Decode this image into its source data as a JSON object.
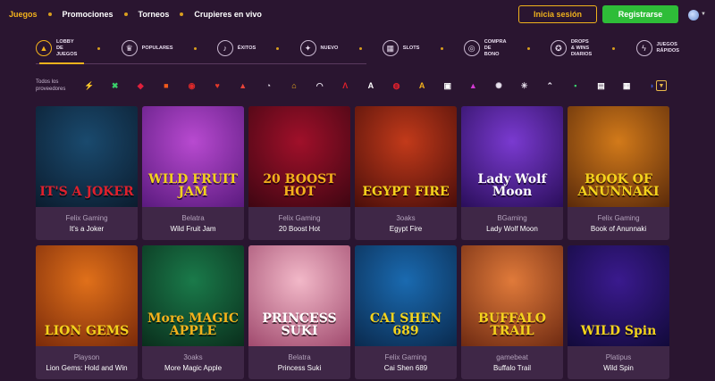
{
  "nav": {
    "links": [
      "Juegos",
      "Promociones",
      "Torneos",
      "Crupieres en vivo"
    ],
    "login_label": "Inicia sesión",
    "register_label": "Registrarse"
  },
  "categories": [
    {
      "label1": "LOBBY",
      "label2": "DE",
      "label3": "JUEGOS",
      "icon": "lobby-icon",
      "glyph": "▲"
    },
    {
      "label1": "POPULARES",
      "label2": "",
      "label3": "",
      "icon": "crown-icon",
      "glyph": "♛"
    },
    {
      "label1": "ÉXITOS",
      "label2": "",
      "label3": "",
      "icon": "microphone-icon",
      "glyph": "♪"
    },
    {
      "label1": "NUEVO",
      "label2": "",
      "label3": "",
      "icon": "new-badge-icon",
      "glyph": "✦"
    },
    {
      "label1": "SLOTS",
      "label2": "",
      "label3": "",
      "icon": "slots-icon",
      "glyph": "▦"
    },
    {
      "label1": "COMPRA",
      "label2": "DE",
      "label3": "BONO",
      "icon": "coins-icon",
      "glyph": "◎"
    },
    {
      "label1": "DROPS",
      "label2": "& WINS",
      "label3": "DIARIOS",
      "icon": "trophy-icon",
      "glyph": "✪"
    },
    {
      "label1": "JUEGOS",
      "label2": "RÁPIDOS",
      "label3": "",
      "icon": "lightning-icon",
      "glyph": "ϟ"
    }
  ],
  "providers": {
    "label1": "Todos los",
    "label2": "proveedores",
    "logos": [
      {
        "icon": "provider-logo-1",
        "glyph": "⚡",
        "color": "#f3b21c"
      },
      {
        "icon": "provider-logo-2",
        "glyph": "✖",
        "color": "#3ad06a"
      },
      {
        "icon": "provider-logo-3",
        "glyph": "◆",
        "color": "#e0203c"
      },
      {
        "icon": "provider-logo-4",
        "glyph": "■",
        "color": "#f05a1c"
      },
      {
        "icon": "provider-logo-5",
        "glyph": "◉",
        "color": "#e02a2a"
      },
      {
        "icon": "provider-logo-6",
        "glyph": "♥",
        "color": "#e23a2a"
      },
      {
        "icon": "provider-logo-7",
        "glyph": "▲",
        "color": "#e8453a"
      },
      {
        "icon": "provider-logo-8",
        "glyph": "◔",
        "color": "#e9e2ee"
      },
      {
        "icon": "provider-logo-9",
        "glyph": "⌂",
        "color": "#f3b21c"
      },
      {
        "icon": "provider-logo-10",
        "glyph": "◠",
        "color": "#e9e2ee"
      },
      {
        "icon": "provider-logo-11",
        "glyph": "Λ",
        "color": "#e0202c"
      },
      {
        "icon": "provider-logo-12",
        "glyph": "A",
        "color": "#ffffff"
      },
      {
        "icon": "provider-logo-13",
        "glyph": "◍",
        "color": "#e0202c"
      },
      {
        "icon": "provider-logo-14",
        "glyph": "A",
        "color": "#f3b21c"
      },
      {
        "icon": "provider-logo-15",
        "glyph": "▣",
        "color": "#ffffff"
      },
      {
        "icon": "provider-logo-16",
        "glyph": "▲",
        "color": "#d43ad4"
      },
      {
        "icon": "provider-logo-17",
        "glyph": "✺",
        "color": "#e9e2ee"
      },
      {
        "icon": "provider-logo-18",
        "glyph": "✳",
        "color": "#e9e2ee"
      },
      {
        "icon": "provider-logo-19",
        "glyph": "⌃",
        "color": "#e9e2ee"
      },
      {
        "icon": "provider-logo-20",
        "glyph": "▪",
        "color": "#3ad06a"
      },
      {
        "icon": "provider-logo-21",
        "glyph": "▤",
        "color": "#ffffff"
      },
      {
        "icon": "provider-logo-22",
        "glyph": "▦",
        "color": "#ffffff"
      },
      {
        "icon": "provider-logo-23",
        "glyph": "◗",
        "color": "#3a5ad0"
      }
    ]
  },
  "games": [
    {
      "provider": "Felix Gaming",
      "name": "It's a Joker",
      "art_title": "IT'S A JOKER",
      "bg1": "#1a4a6e",
      "bg2": "#0b1c2e",
      "tc": "#e0202c"
    },
    {
      "provider": "Belatra",
      "name": "Wild Fruit Jam",
      "art_title": "WILD FRUIT JAM",
      "bg1": "#b84ad0",
      "bg2": "#5a1a7e",
      "tc": "#f3d21c"
    },
    {
      "provider": "Felix Gaming",
      "name": "20 Boost Hot",
      "art_title": "20 BOOST HOT",
      "bg1": "#a0102a",
      "bg2": "#3e0612",
      "tc": "#f3b21c"
    },
    {
      "provider": "3oaks",
      "name": "Egypt Fire",
      "art_title": "EGYPT FIRE",
      "bg1": "#c23a1a",
      "bg2": "#4a0e0a",
      "tc": "#f3d21c"
    },
    {
      "provider": "BGaming",
      "name": "Lady Wolf Moon",
      "art_title": "Lady Wolf Moon",
      "bg1": "#7a3ad0",
      "bg2": "#2a0e5a",
      "tc": "#ffffff"
    },
    {
      "provider": "Felix Gaming",
      "name": "Book of Anunnaki",
      "art_title": "BOOK OF ANUNNAKI",
      "bg1": "#d27a1a",
      "bg2": "#5a2a0a",
      "tc": "#f3d21c"
    },
    {
      "provider": "Playson",
      "name": "Lion Gems: Hold and Win",
      "art_title": "LION GEMS",
      "bg1": "#e0701a",
      "bg2": "#7a2a0a",
      "tc": "#f3d21c"
    },
    {
      "provider": "3oaks",
      "name": "More Magic Apple",
      "art_title": "More MAGIC APPLE",
      "bg1": "#1a7a4a",
      "bg2": "#0a2e1c",
      "tc": "#f3b21c"
    },
    {
      "provider": "Belatra",
      "name": "Princess Suki",
      "art_title": "PRINCESS SUKI",
      "bg1": "#f2b8c8",
      "bg2": "#a04a6e",
      "tc": "#ffffff"
    },
    {
      "provider": "Felix Gaming",
      "name": "Cai Shen 689",
      "art_title": "CAI SHEN 689",
      "bg1": "#1a6ab0",
      "bg2": "#0a2a4e",
      "tc": "#f3d21c"
    },
    {
      "provider": "gamebeat",
      "name": "Buffalo Trail",
      "art_title": "BUFFALO TRAIL",
      "bg1": "#e07a3a",
      "bg2": "#6e2a12",
      "tc": "#f3d21c"
    },
    {
      "provider": "Platipus",
      "name": "Wild Spin",
      "art_title": "WILD Spin",
      "bg1": "#3a1a8e",
      "bg2": "#120a3a",
      "tc": "#f3d21c"
    }
  ]
}
